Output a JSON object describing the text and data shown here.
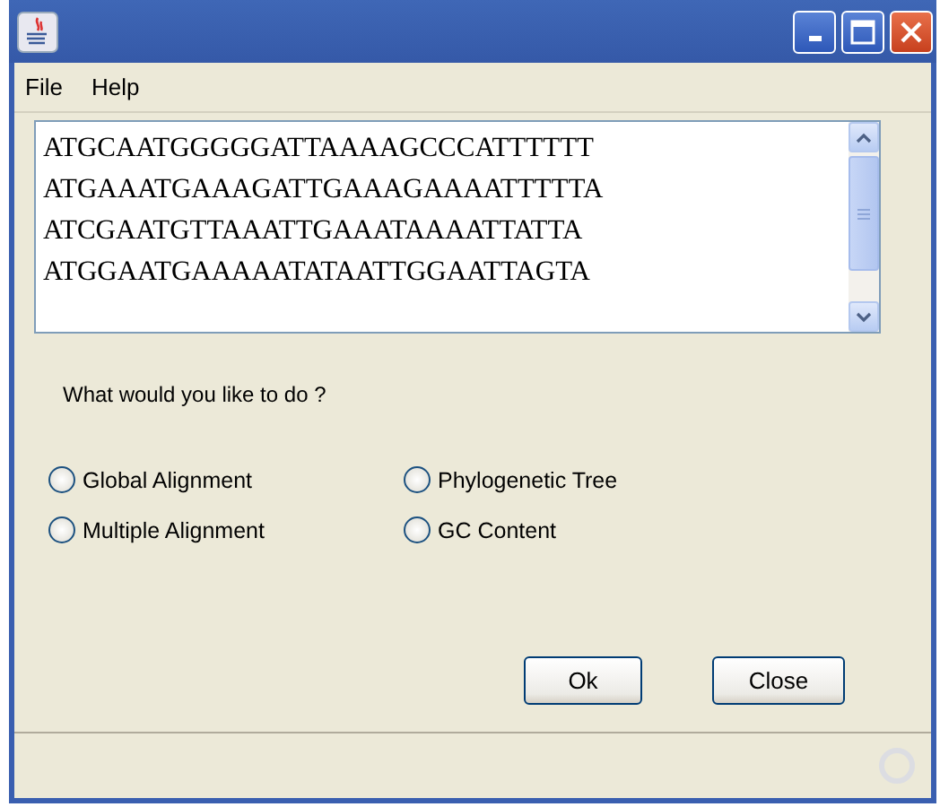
{
  "menu": [
    "File",
    "Help"
  ],
  "sequences": [
    "ATGCAATGGGGGATTAAAAGCCCATTTTTT",
    "ATGAAATGAAAGATTGAAAGAAAATTTTTA",
    "ATCGAATGTTAAATTGAAATAAAATTATTA",
    "ATGGAATGAAAAATATAATTGGAATTAGTA"
  ],
  "question": "What would you like to do ?",
  "options": [
    {
      "label": "Global Alignment",
      "selected": false
    },
    {
      "label": "Phylogenetic Tree",
      "selected": false
    },
    {
      "label": "Multiple Alignment",
      "selected": false
    },
    {
      "label": "GC Content",
      "selected": false
    }
  ],
  "buttons": [
    "Ok",
    "Close"
  ]
}
